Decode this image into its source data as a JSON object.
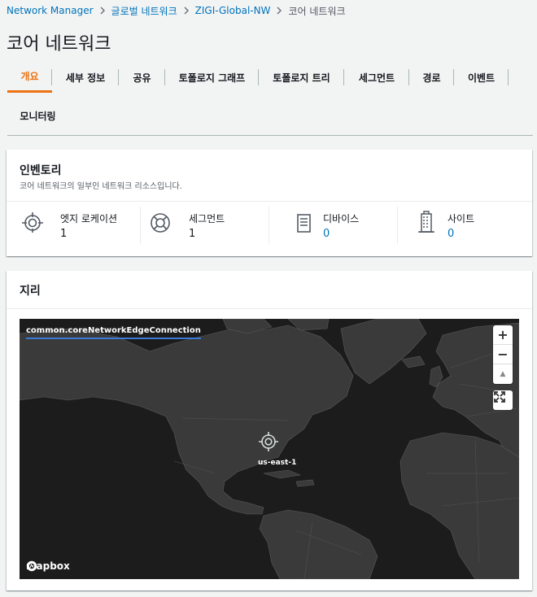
{
  "breadcrumb": [
    "Network Manager",
    "글로벌 네트워크",
    "ZIGI-Global-NW",
    "코어 네트워크"
  ],
  "page_title": "코어 네트워크",
  "tabs": [
    "개요",
    "세부 정보",
    "공유",
    "토폴로지 그래프",
    "토폴로지 트리",
    "세그먼트",
    "경로",
    "이벤트",
    "모니터링"
  ],
  "inventory": {
    "title": "인벤토리",
    "subtitle": "코어 네트워크의 일부인 네트워크 리소스입니다.",
    "items": [
      {
        "label": "엣지 로케이션",
        "value": "1",
        "icon": "edge-location-icon"
      },
      {
        "label": "세그먼트",
        "value": "1",
        "icon": "segment-icon"
      },
      {
        "label": "디바이스",
        "value": "0",
        "icon": "device-icon"
      },
      {
        "label": "사이트",
        "value": "0",
        "icon": "site-icon"
      }
    ]
  },
  "geo": {
    "title": "지리",
    "legend": "common.coreNetworkEdgeConnection",
    "edge_label": "us-east-1",
    "attribution": "mapbox",
    "controls": {
      "zoom_in": "+",
      "zoom_out": "−",
      "compass": "▲"
    }
  },
  "colors": {
    "accent": "#ec7211",
    "link": "#0073bb",
    "map_bg": "#1c1c1c",
    "land": "#3a3a3a"
  }
}
